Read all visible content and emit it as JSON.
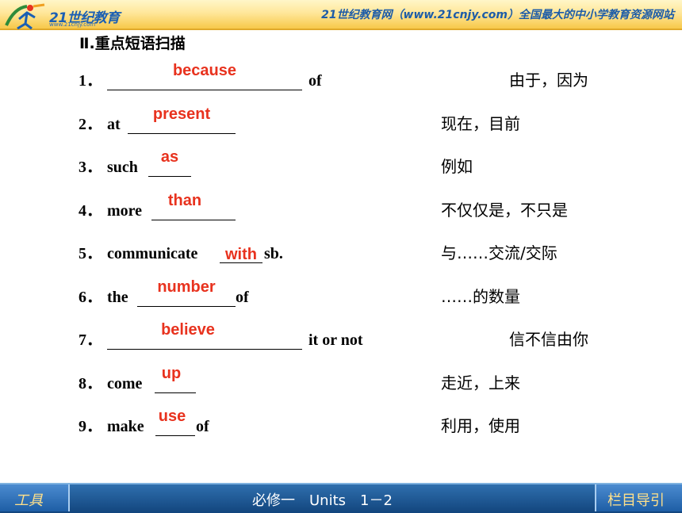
{
  "header": {
    "logo_text": "21世纪教育",
    "logo_subtext": "www.21cnjy.com",
    "site_banner": "21世纪教育网（www.21cnjy.com）全国最大的中小学教育资源网站"
  },
  "section": {
    "heading": "Ⅱ.重点短语扫描"
  },
  "rows": [
    {
      "num": "1．",
      "prefix": "",
      "answer": "because",
      "suffix": "of",
      "meaning": "由于，因为"
    },
    {
      "num": "2．",
      "prefix": "at",
      "answer": "present",
      "suffix": "",
      "meaning": "现在，目前"
    },
    {
      "num": "3．",
      "prefix": "such",
      "answer": "as",
      "suffix": "",
      "meaning": "例如"
    },
    {
      "num": "4．",
      "prefix": "more",
      "answer": "than",
      "suffix": "",
      "meaning": "不仅仅是，不只是"
    },
    {
      "num": "5．",
      "prefix": "communicate",
      "answer": "with",
      "suffix": "sb.",
      "meaning": "与……交流/交际"
    },
    {
      "num": "6．",
      "prefix": "the",
      "answer": "number",
      "suffix": "of",
      "meaning": "……的数量"
    },
    {
      "num": "7．",
      "prefix": "",
      "answer": "believe",
      "suffix": "it or not",
      "meaning": "信不信由你"
    },
    {
      "num": "8．",
      "prefix": "come",
      "answer": "up",
      "suffix": "",
      "meaning": "走近，上来"
    },
    {
      "num": "9．",
      "prefix": "make",
      "answer": "use",
      "suffix": "of",
      "meaning": "利用，使用"
    }
  ],
  "footer": {
    "tools_label": "工具",
    "title": "必修一　Units　1－2",
    "nav_label": "栏目导引"
  },
  "colors": {
    "answer": "#e8321e",
    "footer_bg": "#1e5ea5",
    "header_bg": "#f7c84a"
  }
}
